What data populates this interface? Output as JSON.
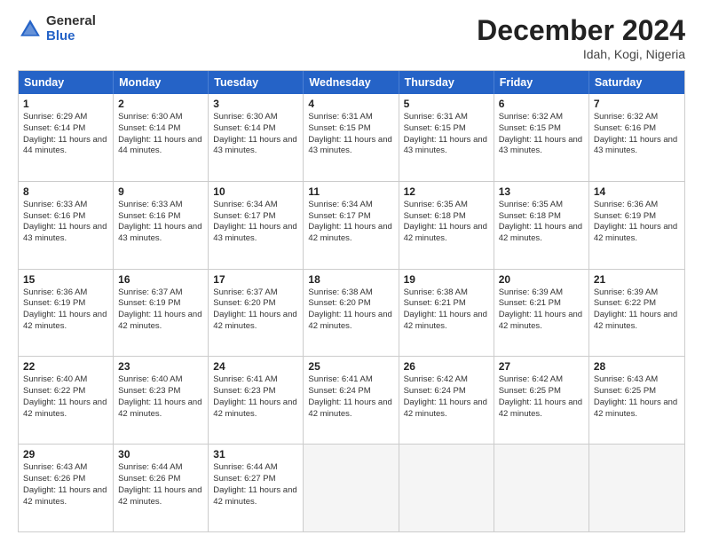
{
  "header": {
    "logo_general": "General",
    "logo_blue": "Blue",
    "title": "December 2024",
    "location": "Idah, Kogi, Nigeria"
  },
  "days_of_week": [
    "Sunday",
    "Monday",
    "Tuesday",
    "Wednesday",
    "Thursday",
    "Friday",
    "Saturday"
  ],
  "weeks": [
    [
      {
        "day": 1,
        "sunrise": "6:29 AM",
        "sunset": "6:14 PM",
        "daylight": "11 hours and 44 minutes."
      },
      {
        "day": 2,
        "sunrise": "6:30 AM",
        "sunset": "6:14 PM",
        "daylight": "11 hours and 44 minutes."
      },
      {
        "day": 3,
        "sunrise": "6:30 AM",
        "sunset": "6:14 PM",
        "daylight": "11 hours and 43 minutes."
      },
      {
        "day": 4,
        "sunrise": "6:31 AM",
        "sunset": "6:15 PM",
        "daylight": "11 hours and 43 minutes."
      },
      {
        "day": 5,
        "sunrise": "6:31 AM",
        "sunset": "6:15 PM",
        "daylight": "11 hours and 43 minutes."
      },
      {
        "day": 6,
        "sunrise": "6:32 AM",
        "sunset": "6:15 PM",
        "daylight": "11 hours and 43 minutes."
      },
      {
        "day": 7,
        "sunrise": "6:32 AM",
        "sunset": "6:16 PM",
        "daylight": "11 hours and 43 minutes."
      }
    ],
    [
      {
        "day": 8,
        "sunrise": "6:33 AM",
        "sunset": "6:16 PM",
        "daylight": "11 hours and 43 minutes."
      },
      {
        "day": 9,
        "sunrise": "6:33 AM",
        "sunset": "6:16 PM",
        "daylight": "11 hours and 43 minutes."
      },
      {
        "day": 10,
        "sunrise": "6:34 AM",
        "sunset": "6:17 PM",
        "daylight": "11 hours and 43 minutes."
      },
      {
        "day": 11,
        "sunrise": "6:34 AM",
        "sunset": "6:17 PM",
        "daylight": "11 hours and 42 minutes."
      },
      {
        "day": 12,
        "sunrise": "6:35 AM",
        "sunset": "6:18 PM",
        "daylight": "11 hours and 42 minutes."
      },
      {
        "day": 13,
        "sunrise": "6:35 AM",
        "sunset": "6:18 PM",
        "daylight": "11 hours and 42 minutes."
      },
      {
        "day": 14,
        "sunrise": "6:36 AM",
        "sunset": "6:19 PM",
        "daylight": "11 hours and 42 minutes."
      }
    ],
    [
      {
        "day": 15,
        "sunrise": "6:36 AM",
        "sunset": "6:19 PM",
        "daylight": "11 hours and 42 minutes."
      },
      {
        "day": 16,
        "sunrise": "6:37 AM",
        "sunset": "6:19 PM",
        "daylight": "11 hours and 42 minutes."
      },
      {
        "day": 17,
        "sunrise": "6:37 AM",
        "sunset": "6:20 PM",
        "daylight": "11 hours and 42 minutes."
      },
      {
        "day": 18,
        "sunrise": "6:38 AM",
        "sunset": "6:20 PM",
        "daylight": "11 hours and 42 minutes."
      },
      {
        "day": 19,
        "sunrise": "6:38 AM",
        "sunset": "6:21 PM",
        "daylight": "11 hours and 42 minutes."
      },
      {
        "day": 20,
        "sunrise": "6:39 AM",
        "sunset": "6:21 PM",
        "daylight": "11 hours and 42 minutes."
      },
      {
        "day": 21,
        "sunrise": "6:39 AM",
        "sunset": "6:22 PM",
        "daylight": "11 hours and 42 minutes."
      }
    ],
    [
      {
        "day": 22,
        "sunrise": "6:40 AM",
        "sunset": "6:22 PM",
        "daylight": "11 hours and 42 minutes."
      },
      {
        "day": 23,
        "sunrise": "6:40 AM",
        "sunset": "6:23 PM",
        "daylight": "11 hours and 42 minutes."
      },
      {
        "day": 24,
        "sunrise": "6:41 AM",
        "sunset": "6:23 PM",
        "daylight": "11 hours and 42 minutes."
      },
      {
        "day": 25,
        "sunrise": "6:41 AM",
        "sunset": "6:24 PM",
        "daylight": "11 hours and 42 minutes."
      },
      {
        "day": 26,
        "sunrise": "6:42 AM",
        "sunset": "6:24 PM",
        "daylight": "11 hours and 42 minutes."
      },
      {
        "day": 27,
        "sunrise": "6:42 AM",
        "sunset": "6:25 PM",
        "daylight": "11 hours and 42 minutes."
      },
      {
        "day": 28,
        "sunrise": "6:43 AM",
        "sunset": "6:25 PM",
        "daylight": "11 hours and 42 minutes."
      }
    ],
    [
      {
        "day": 29,
        "sunrise": "6:43 AM",
        "sunset": "6:26 PM",
        "daylight": "11 hours and 42 minutes."
      },
      {
        "day": 30,
        "sunrise": "6:44 AM",
        "sunset": "6:26 PM",
        "daylight": "11 hours and 42 minutes."
      },
      {
        "day": 31,
        "sunrise": "6:44 AM",
        "sunset": "6:27 PM",
        "daylight": "11 hours and 42 minutes."
      },
      null,
      null,
      null,
      null
    ]
  ]
}
